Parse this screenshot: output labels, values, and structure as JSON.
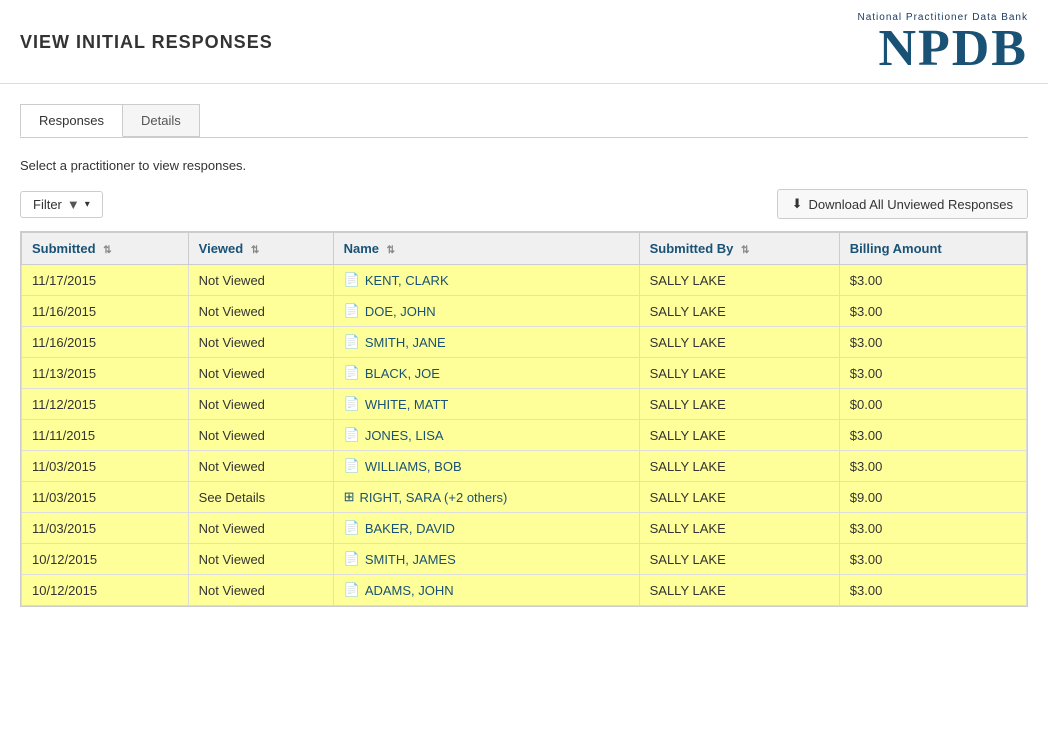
{
  "header": {
    "title": "VIEW INITIAL RESPONSES",
    "logo_small": "National Practitioner Data Bank",
    "logo_big": "NPDB"
  },
  "tabs": [
    {
      "id": "responses",
      "label": "Responses",
      "active": true
    },
    {
      "id": "details",
      "label": "Details",
      "active": false
    }
  ],
  "instructions": "Select a practitioner to view responses.",
  "toolbar": {
    "filter_label": "Filter",
    "download_label": "Download All Unviewed Responses"
  },
  "table": {
    "columns": [
      {
        "id": "submitted",
        "label": "Submitted"
      },
      {
        "id": "viewed",
        "label": "Viewed"
      },
      {
        "id": "name",
        "label": "Name"
      },
      {
        "id": "submitted_by",
        "label": "Submitted By"
      },
      {
        "id": "billing_amount",
        "label": "Billing Amount"
      }
    ],
    "rows": [
      {
        "submitted": "11/17/2015",
        "viewed": "Not Viewed",
        "name": "KENT, CLARK",
        "name_type": "doc",
        "submitted_by": "SALLY LAKE",
        "billing_amount": "$3.00"
      },
      {
        "submitted": "11/16/2015",
        "viewed": "Not Viewed",
        "name": "DOE, JOHN",
        "name_type": "doc",
        "submitted_by": "SALLY LAKE",
        "billing_amount": "$3.00"
      },
      {
        "submitted": "11/16/2015",
        "viewed": "Not Viewed",
        "name": "SMITH, JANE",
        "name_type": "doc",
        "submitted_by": "SALLY LAKE",
        "billing_amount": "$3.00"
      },
      {
        "submitted": "11/13/2015",
        "viewed": "Not Viewed",
        "name": "BLACK, JOE",
        "name_type": "doc",
        "submitted_by": "SALLY LAKE",
        "billing_amount": "$3.00"
      },
      {
        "submitted": "11/12/2015",
        "viewed": "Not Viewed",
        "name": "WHITE, MATT",
        "name_type": "doc",
        "submitted_by": "SALLY LAKE",
        "billing_amount": "$0.00"
      },
      {
        "submitted": "11/11/2015",
        "viewed": "Not Viewed",
        "name": "JONES, LISA",
        "name_type": "doc",
        "submitted_by": "SALLY LAKE",
        "billing_amount": "$3.00"
      },
      {
        "submitted": "11/03/2015",
        "viewed": "Not Viewed",
        "name": "WILLIAMS, BOB",
        "name_type": "doc",
        "submitted_by": "SALLY LAKE",
        "billing_amount": "$3.00"
      },
      {
        "submitted": "11/03/2015",
        "viewed": "See Details",
        "name": "RIGHT, SARA (+2 others)",
        "name_type": "expand",
        "submitted_by": "SALLY LAKE",
        "billing_amount": "$9.00"
      },
      {
        "submitted": "11/03/2015",
        "viewed": "Not Viewed",
        "name": "BAKER, DAVID",
        "name_type": "doc",
        "submitted_by": "SALLY LAKE",
        "billing_amount": "$3.00"
      },
      {
        "submitted": "10/12/2015",
        "viewed": "Not Viewed",
        "name": "SMITH, JAMES",
        "name_type": "doc",
        "submitted_by": "SALLY LAKE",
        "billing_amount": "$3.00"
      },
      {
        "submitted": "10/12/2015",
        "viewed": "Not Viewed",
        "name": "ADAMS, JOHN",
        "name_type": "doc",
        "submitted_by": "SALLY LAKE",
        "billing_amount": "$3.00"
      }
    ]
  }
}
